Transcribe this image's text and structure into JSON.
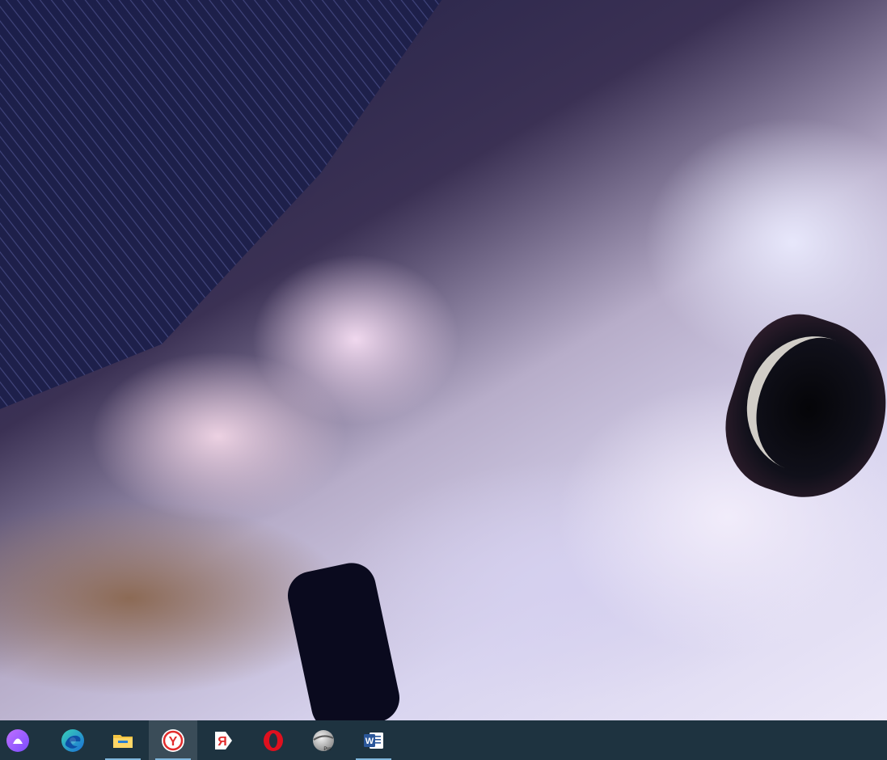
{
  "wallpaper": {
    "description_colors": {
      "hood": "#1c1f4a",
      "skin_light": "#ece8f8",
      "hair": "#8c6a55"
    }
  },
  "taskbar": {
    "background": "#1e3340",
    "active_highlight": "#3a4c58",
    "running_indicator": "#7fb6dc",
    "items": [
      {
        "id": "alice",
        "icon": "alice-assistant-icon",
        "running": false,
        "active": false
      },
      {
        "id": "edge",
        "icon": "edge-icon",
        "running": false,
        "active": false
      },
      {
        "id": "explorer",
        "icon": "file-explorer-icon",
        "running": true,
        "active": false
      },
      {
        "id": "yandex-browser",
        "icon": "yandex-browser-icon",
        "running": true,
        "active": true
      },
      {
        "id": "yandex",
        "icon": "yandex-icon",
        "running": false,
        "active": false
      },
      {
        "id": "opera",
        "icon": "opera-icon",
        "running": false,
        "active": false
      },
      {
        "id": "google-earth-pro",
        "icon": "google-earth-pro-icon",
        "running": false,
        "active": false
      },
      {
        "id": "word",
        "icon": "word-icon",
        "running": true,
        "active": false
      }
    ],
    "glyphs": {
      "yandex_y": "Y",
      "yandex_ya": "Я",
      "word_w": "W",
      "earth_pro": "Pro"
    }
  }
}
